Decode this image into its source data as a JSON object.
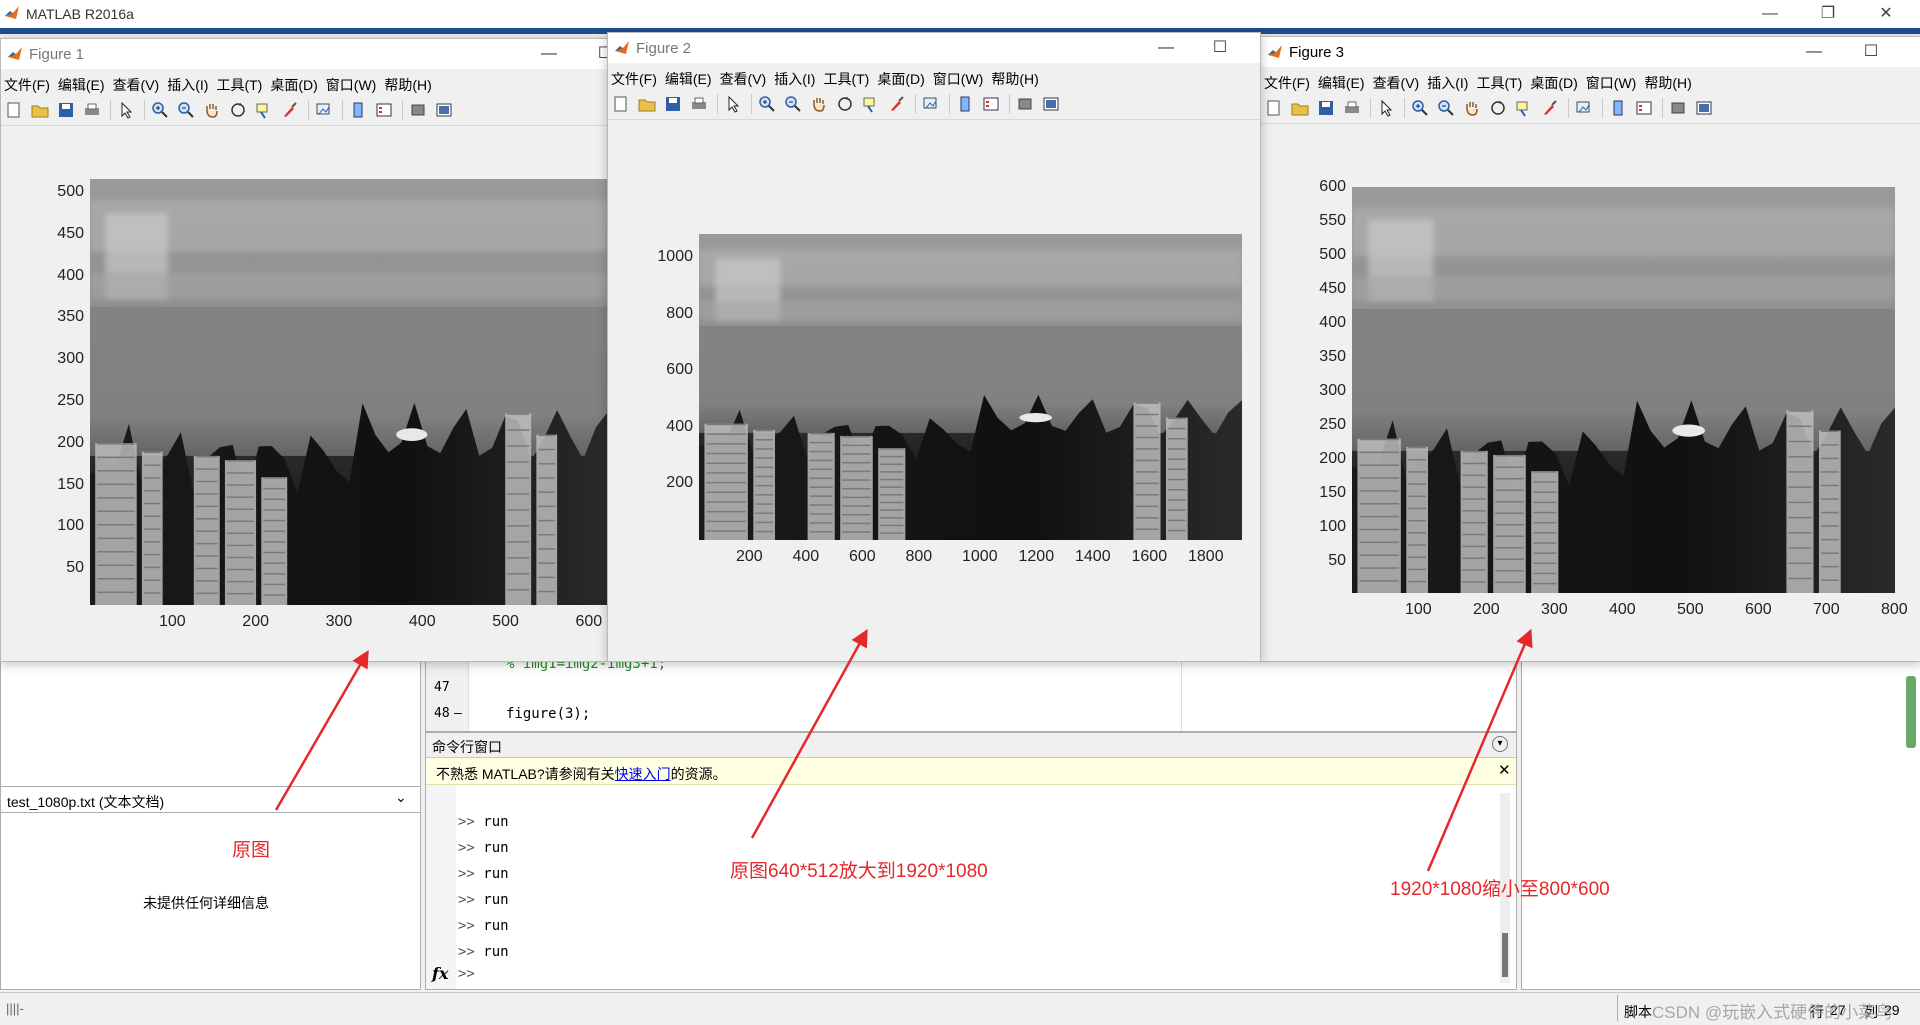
{
  "app": {
    "title": "MATLAB R2016a"
  },
  "menus": [
    "文件(F)",
    "编辑(E)",
    "查看(V)",
    "插入(I)",
    "工具(T)",
    "桌面(D)",
    "窗口(W)",
    "帮助(H)"
  ],
  "figures": [
    {
      "title": "Figure 1",
      "ylabels": [
        "500",
        "450",
        "400",
        "350",
        "300",
        "250",
        "200",
        "150",
        "100",
        "50"
      ],
      "xlabels": [
        "100",
        "200",
        "300",
        "400",
        "500",
        "600"
      ]
    },
    {
      "title": "Figure 2",
      "ylabels": [
        "1000",
        "800",
        "600",
        "400",
        "200"
      ],
      "xlabels": [
        "200",
        "400",
        "600",
        "800",
        "1000",
        "1200",
        "1400",
        "1600",
        "1800"
      ]
    },
    {
      "title": "Figure 3",
      "ylabels": [
        "600",
        "550",
        "500",
        "450",
        "400",
        "350",
        "300",
        "250",
        "200",
        "150",
        "100",
        "50"
      ],
      "xlabels": [
        "100",
        "200",
        "300",
        "400",
        "500",
        "600",
        "700",
        "800"
      ]
    }
  ],
  "editor": {
    "lines": [
      {
        "num": "47",
        "dash": "",
        "code": ""
      },
      {
        "num": "48",
        "dash": "—",
        "code": "figure(3);"
      }
    ],
    "partial_code": "% img1=img2-img3+1;"
  },
  "file_details": {
    "selected_file": "test_1080p.txt  (文本文档)",
    "message": "未提供任何详细信息"
  },
  "command_window": {
    "title": "命令行窗口",
    "banner_prefix": "不熟悉 MATLAB?请参阅有关",
    "banner_link": "快速入门",
    "banner_suffix": "的资源。",
    "prompt": ">>",
    "history": [
      "run",
      "run",
      "run",
      "run",
      "run",
      "run"
    ],
    "fx": "fx"
  },
  "statusbar": {
    "mode": "脚本",
    "row_label": "行",
    "row": "27",
    "col_label": "列",
    "col": "29",
    "watermark": "CSDN @玩嵌入式硬件的小菜鸟"
  },
  "annotations": {
    "fig1": "原图",
    "fig2": "原图640*512放大到1920*1080",
    "fig3": "1920*1080缩小至800*600"
  },
  "colors": {
    "annotation": "#e5282b",
    "link": "#0000ee",
    "banner_bg": "#ffffe1"
  }
}
